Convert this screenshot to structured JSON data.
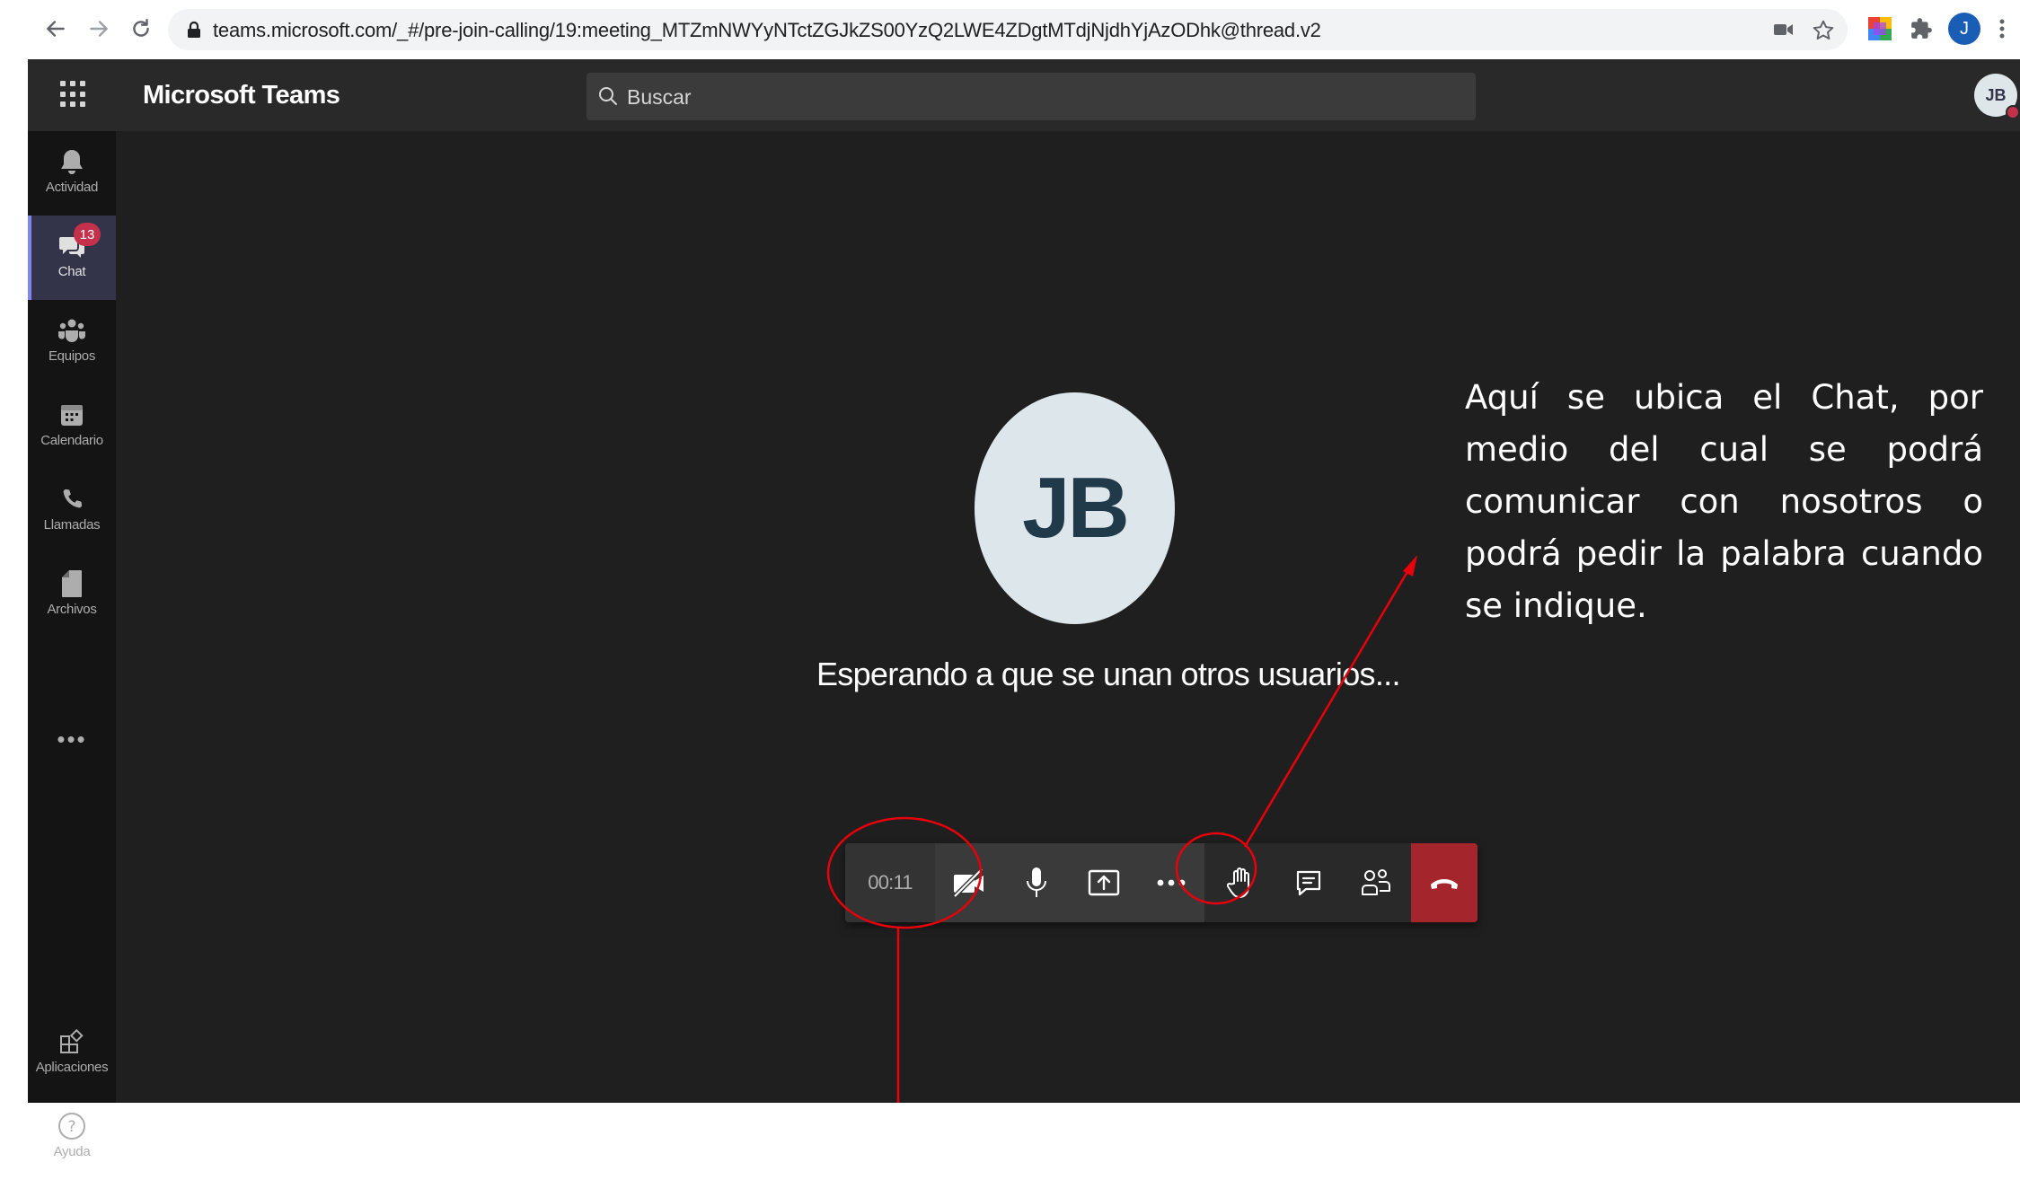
{
  "browser": {
    "url": "teams.microsoft.com/_#/pre-join-calling/19:meeting_MTZmNWYyNTctZGJkZS00YzQ2LWE4ZDgtMTdjNjdhYjAzODhk@thread.v2",
    "profile_initial": "J"
  },
  "app": {
    "title": "Microsoft Teams",
    "search_placeholder": "Buscar",
    "user_initials": "JB"
  },
  "rail": {
    "items": [
      {
        "label": "Actividad",
        "icon": "bell-icon"
      },
      {
        "label": "Chat",
        "icon": "chat-icon",
        "badge": "13"
      },
      {
        "label": "Equipos",
        "icon": "teams-icon"
      },
      {
        "label": "Calendario",
        "icon": "calendar-icon"
      },
      {
        "label": "Llamadas",
        "icon": "phone-icon"
      },
      {
        "label": "Archivos",
        "icon": "file-icon"
      }
    ],
    "more": "•••",
    "bottom": [
      {
        "label": "Aplicaciones",
        "icon": "apps-icon"
      },
      {
        "label": "Ayuda",
        "icon": "help-icon"
      }
    ]
  },
  "meeting": {
    "avatar_initials": "JB",
    "status": "Esperando a que se unan otros usuarios...",
    "timer": "00:11",
    "controls": [
      "camera-off-icon",
      "microphone-icon",
      "share-screen-icon",
      "more-icon",
      "raise-hand-icon",
      "chat-icon",
      "participants-icon",
      "hang-up-icon"
    ]
  },
  "annotation": {
    "text": "Aquí se ubica el Chat, por medio del cual se podrá comunicar con nosotros o podrá pedir la palabra cuando se indique.",
    "color": "#e8000b"
  },
  "colors": {
    "accent": "#7f85f5",
    "hangup": "#a4262c",
    "badge": "#c4314b"
  }
}
